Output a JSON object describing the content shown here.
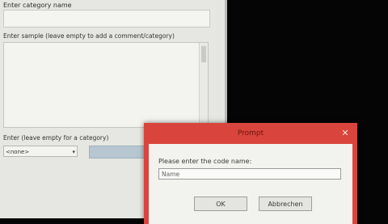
{
  "background_window": {
    "title": "Enter category name",
    "comment_label": "Enter sample (leave empty to add a comment/category)",
    "category_label": "Enter (leave empty for a category)",
    "category_select_value": "<none>"
  },
  "dialog": {
    "title": "Prompt",
    "close_glyph": "✕",
    "prompt_text": "Please enter the code name:",
    "input_value": "Name",
    "ok_label": "OK",
    "cancel_label": "Abbrechen"
  },
  "colors": {
    "dialog_frame": "#d9453c",
    "window_bg": "#e6e7e2",
    "screen_bg": "#050505"
  }
}
